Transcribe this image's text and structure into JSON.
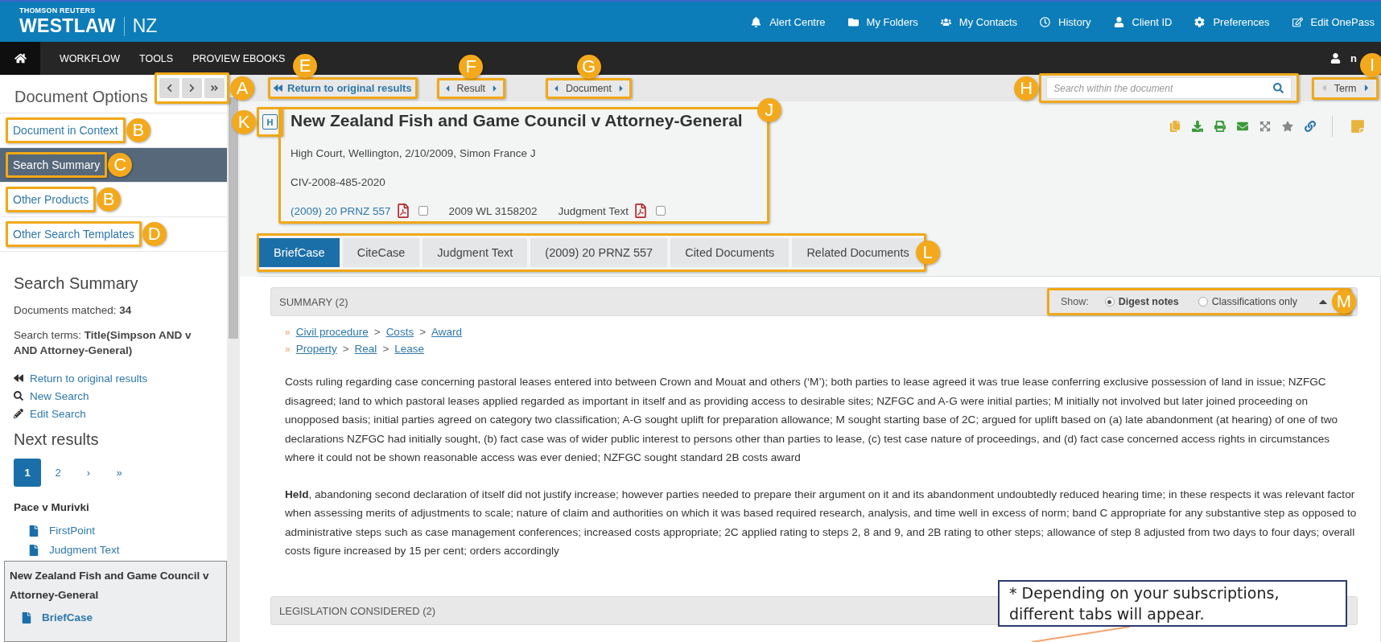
{
  "header": {
    "brand_top": "THOMSON REUTERS",
    "brand": "WESTLAW",
    "region": "NZ",
    "links": [
      {
        "kind": "bell",
        "label": "Alert Centre"
      },
      {
        "kind": "folder",
        "label": "My Folders"
      },
      {
        "kind": "users",
        "label": "My Contacts"
      },
      {
        "kind": "clock",
        "label": "History"
      },
      {
        "kind": "user",
        "label": "Client ID"
      },
      {
        "kind": "cog",
        "label": "Preferences"
      },
      {
        "kind": "edit",
        "label": "Edit OnePass"
      }
    ]
  },
  "nav": {
    "items": [
      "WORKFLOW",
      "TOOLS",
      "PROVIEW EBOOKS"
    ],
    "user": "n"
  },
  "sidebar": {
    "title": "Document Options",
    "pager_callout": "A",
    "menu": [
      {
        "label": "Document in Context",
        "selected": false,
        "callout": "B"
      },
      {
        "label": "Search Summary",
        "selected": true,
        "callout": "C"
      },
      {
        "label": "Other Products",
        "selected": false,
        "callout": "B"
      },
      {
        "label": "Other Search Templates",
        "selected": false,
        "callout": "D"
      }
    ],
    "summary_heading": "Search Summary",
    "matched": "Documents matched: **34**",
    "terms": "Search terms: **Title(Simpson AND v AND Attorney-General)**",
    "links": [
      {
        "kind": "back",
        "label": "Return to original results"
      },
      {
        "kind": "search",
        "label": "New Search"
      },
      {
        "kind": "pencil",
        "label": "Edit Search"
      }
    ],
    "next_heading": "Next results",
    "pages": [
      {
        "label": "1",
        "selected": true
      },
      {
        "label": "2",
        "selected": false
      },
      {
        "label": "›",
        "selected": false
      },
      {
        "label": "»",
        "selected": false
      }
    ],
    "results": [
      {
        "title": "Pace v Murivki",
        "docs": [
          "FirstPoint",
          "Judgment Text"
        ]
      }
    ],
    "current_result": {
      "title": "New Zealand Fish and Game Council v Attorney-General",
      "docs": [
        "BriefCase"
      ]
    }
  },
  "toolbar": {
    "back": {
      "label": "Return to original results",
      "callout": "E"
    },
    "result": {
      "label": "Result",
      "callout": "F"
    },
    "document": {
      "label": "Document",
      "callout": "G"
    },
    "search": {
      "placeholder": "Search within the document",
      "callout": "H"
    },
    "term": {
      "label": "Term",
      "callout": "I"
    }
  },
  "document": {
    "badge": "H",
    "badge_callout": "K",
    "title": "New Zealand Fish and Game Council v Attorney-General",
    "callout": "J",
    "court": "High Court, Wellington, 2/10/2009, Simon France J",
    "number": "CIV-2008-485-2020",
    "citations": [
      {
        "kind": "link",
        "label": "(2009) 20 PRNZ 557",
        "checked": false
      },
      {
        "kind": "plain",
        "label": "2009 WL 3158202"
      },
      {
        "kind": "pdf",
        "label": "Judgment Text",
        "checked": false
      }
    ]
  },
  "tabs": {
    "callout": "L",
    "items": [
      {
        "label": "BriefCase",
        "selected": true
      },
      {
        "label": "CiteCase",
        "selected": false
      },
      {
        "label": "Judgment Text",
        "selected": false
      },
      {
        "label": "(2009) 20 PRNZ 557",
        "selected": false
      },
      {
        "label": "Cited Documents",
        "selected": false
      },
      {
        "label": "Related Documents",
        "selected": false
      }
    ]
  },
  "summary": {
    "heading": "SUMMARY (2)",
    "show_label": "Show:",
    "callout": "M",
    "expanded": true,
    "options": [
      {
        "label": "Digest notes",
        "selected": true
      },
      {
        "label": "Classifications only",
        "selected": false
      }
    ],
    "bullet": "»",
    "separator": ">",
    "classifications": [
      [
        "Civil procedure",
        "Costs",
        "Award"
      ],
      [
        "Property",
        "Real",
        "Lease"
      ]
    ],
    "paragraphs": [
      "Costs ruling regarding case concerning pastoral leases entered into between Crown and Mouat and others (‘M’); both parties to lease agreed it was true lease conferring exclusive possession of land in issue; NZFGC disagreed; land to which pastoral leases applied regarded as important in itself and as providing access to desirable sites; NZFGC and A-G were initial parties; M initially not involved but later joined proceeding on unopposed basis; initial parties agreed on category two classification; A-G sought uplift for preparation allowance; M sought starting base of 2C; argued for uplift based on (a) late abandonment (at hearing) of one of two declarations NZFGC had initially sought, (b) fact case was of wider public interest to persons other than parties to lease, (c) test case nature of proceedings, and (d) fact case concerned access rights in circumstances where it could not be shown reasonable access was ever denied; NZFGC sought standard 2B costs award",
      "**Held**, abandoning second declaration of itself did not justify increase; however parties needed to prepare their argument on it and its abandonment undoubtedly reduced hearing time; in these respects it was relevant factor when assessing merits of adjustments to scale; nature of claim and authorities on which it was based required research, analysis, and time well in excess of norm; band C appropriate for any substantive step as opposed to administrative steps such as case management conferences; increased costs appropriate; 2C applied rating to steps 2, 8 and 9, and 2B rating to other steps; allowance of step 8 adjusted from two days to four days; overall costs figure increased by 15 per cent; orders accordingly"
    ]
  },
  "legislation": {
    "heading": "LEGISLATION CONSIDERED (2)"
  },
  "note": {
    "text": "* Depending on your subscriptions, different tabs will appear."
  }
}
